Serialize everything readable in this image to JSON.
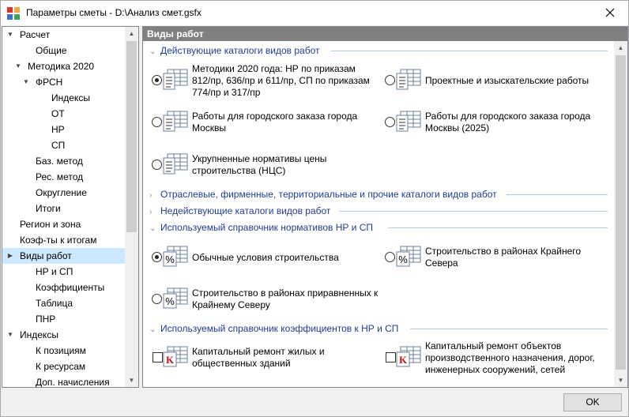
{
  "window": {
    "title": "Параметры сметы - D:\\Анализ смет.gsfx"
  },
  "tree": [
    {
      "label": "Расчет",
      "caret": "v"
    },
    {
      "label": "Общие",
      "caret": ""
    },
    {
      "label": "Методика 2020",
      "caret": "v"
    },
    {
      "label": "ФРСН",
      "caret": "v"
    },
    {
      "label": "Индексы",
      "caret": ""
    },
    {
      "label": "ОТ",
      "caret": ""
    },
    {
      "label": "НР",
      "caret": ""
    },
    {
      "label": "СП",
      "caret": ""
    },
    {
      "label": "Баз. метод",
      "caret": ""
    },
    {
      "label": "Рес. метод",
      "caret": ""
    },
    {
      "label": "Округление",
      "caret": ""
    },
    {
      "label": "Итоги",
      "caret": ""
    },
    {
      "label": "Регион и зона",
      "caret": ""
    },
    {
      "label": "Коэф-ты к итогам",
      "caret": ""
    },
    {
      "label": "Виды работ",
      "caret": ">",
      "selected": true
    },
    {
      "label": "НР и СП",
      "caret": ""
    },
    {
      "label": "Коэффициенты",
      "caret": ""
    },
    {
      "label": "Таблица",
      "caret": ""
    },
    {
      "label": "ПНР",
      "caret": ""
    },
    {
      "label": "Индексы",
      "caret": "v"
    },
    {
      "label": "К позициям",
      "caret": ""
    },
    {
      "label": "К ресурсам",
      "caret": ""
    },
    {
      "label": "Доп. начисления",
      "caret": ""
    }
  ],
  "panel": {
    "header": "Виды работ",
    "sections": {
      "active_catalogs": "Действующие каталоги видов работ",
      "other_catalogs": "Отраслевые, фирменные, территориальные и прочие каталоги видов работ",
      "inactive_catalogs": "Недействующие каталоги видов работ",
      "norms_reference": "Используемый справочник нормативов НР и СП",
      "coef_reference": "Используемый справочник коэффициентов к НР и СП"
    },
    "catalog_options": {
      "methods2020": "Методики 2020 года: НР по приказам 812/пр, 636/пр и 611/пр, СП по приказам 774/пр и 317/пр",
      "design_survey": "Проектные и изыскательские работы",
      "moscow_order": "Работы для городского заказа города Москвы",
      "moscow_order_2025": "Работы для городского заказа города Москвы (2025)",
      "ncs": "Укрупненные нормативы цены строительства (НЦС)"
    },
    "norm_options": {
      "normal": "Обычные условия строительства",
      "far_north": "Строительство в районах Крайнего Севера",
      "equivalent_north": "Строительство в районах приравненных к Крайнему Северу"
    },
    "coef_options": {
      "capital_residential": "Капитальный ремонт жилых и общественных зданий",
      "capital_objects": "Капитальный ремонт объектов производственного назначения, дорог, инженерных сооружений, сетей"
    }
  },
  "buttons": {
    "ok": "OK"
  },
  "colors": {
    "section_text": "#1f3d99",
    "selected_bg": "#cce8ff",
    "header_bg": "#808080"
  },
  "icons": {
    "app": "grid-icon",
    "close": "close-icon",
    "catalog": "catalog-table-icon",
    "percent": "percent-table-icon",
    "coef": "coefficient-k-icon"
  }
}
